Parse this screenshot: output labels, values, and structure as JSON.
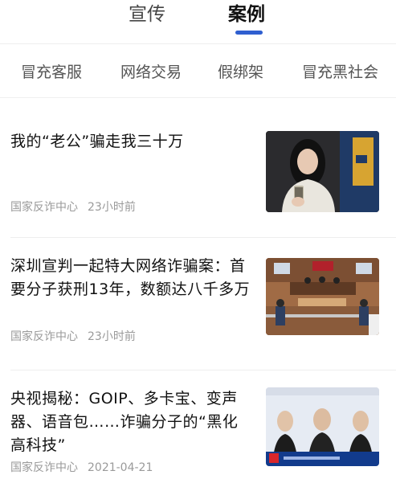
{
  "top_tabs": [
    {
      "label": "宣传",
      "active": false
    },
    {
      "label": "案例",
      "active": true
    }
  ],
  "accent_color": "#2f5fd0",
  "categories": [
    "冒充客服",
    "网络交易",
    "假绑架",
    "冒充黑社会"
  ],
  "articles": [
    {
      "title": "我的“老公”骗走我三十万",
      "source": "国家反诈中心",
      "time": "23小时前",
      "thumbnail": "drama-scene-person-holding-phone"
    },
    {
      "title": "深圳宣判一起特大网络诈骗案：首要分子获刑13年，数额达八千多万",
      "source": "国家反诈中心",
      "time": "23小时前",
      "thumbnail": "courtroom-trial"
    },
    {
      "title": "央视揭秘：GOIP、多卡宝、变声器、语音包……诈骗分子的“黑化高科技”",
      "source": "国家反诈中心",
      "time": "2021-04-21",
      "thumbnail": "tv-news-suspects-lineup"
    }
  ]
}
